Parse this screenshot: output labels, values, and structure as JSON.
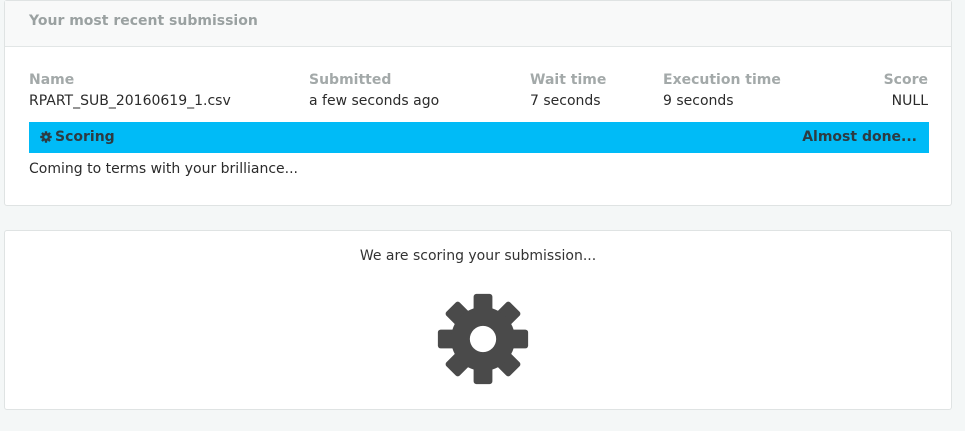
{
  "recent_submission": {
    "header_title": "Your most recent submission",
    "columns": {
      "name": {
        "label": "Name",
        "value": "RPART_SUB_20160619_1.csv"
      },
      "submitted": {
        "label": "Submitted",
        "value": "a few seconds ago"
      },
      "wait_time": {
        "label": "Wait time",
        "value": "7 seconds"
      },
      "execution_time": {
        "label": "Execution time",
        "value": "9 seconds"
      },
      "score": {
        "label": "Score",
        "value": "NULL"
      }
    },
    "status_bar": {
      "icon": "gear-icon",
      "label": "Scoring",
      "progress_text": "Almost done...",
      "color": "#00bbf7"
    },
    "status_message": "Coming to terms with your brilliance..."
  },
  "scoring_panel": {
    "message": "We are scoring your submission...",
    "icon": "gear-icon",
    "icon_color": "#4a4a4a"
  }
}
